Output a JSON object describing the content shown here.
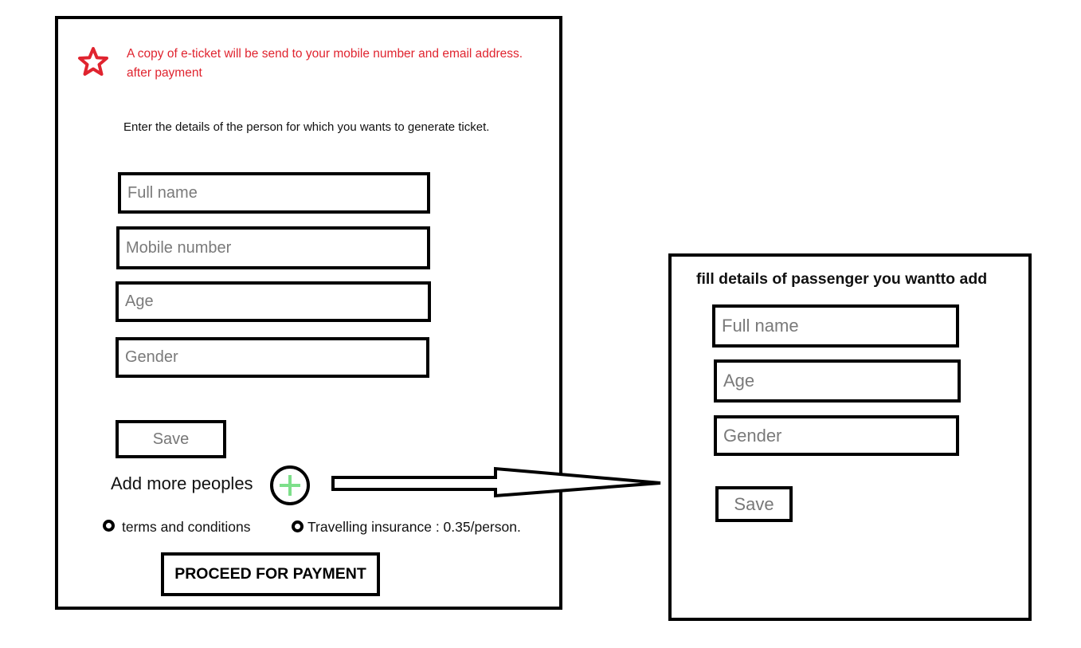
{
  "notice": {
    "icon": "star-icon",
    "color": "#e0242f",
    "line1": "A copy of e-ticket will be send to your mobile number and email address.",
    "line2": "after payment"
  },
  "instructions": "Enter the details of the person for which you wants to generate ticket.",
  "main_form": {
    "full_name_placeholder": "Full name",
    "mobile_placeholder": "Mobile number",
    "age_placeholder": "Age",
    "gender_placeholder": "Gender",
    "save_label": "Save"
  },
  "add_more": {
    "label": "Add more peoples",
    "icon": "plus-circle-icon",
    "plus_color": "#7ddf8a"
  },
  "options": {
    "terms_label": "terms and conditions",
    "insurance_label": "Travelling insurance : 0.35/person."
  },
  "proceed_label": "PROCEED FOR PAYMENT",
  "passenger_form": {
    "title": "fill details of passenger you wantto add",
    "full_name_placeholder": "Full name",
    "age_placeholder": "Age",
    "gender_placeholder": "Gender",
    "save_label": "Save"
  }
}
